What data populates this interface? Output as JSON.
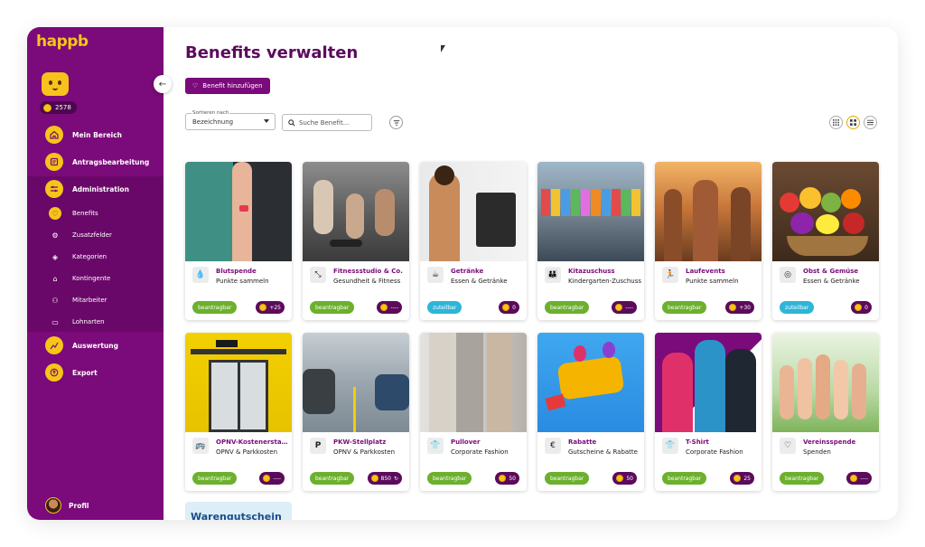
{
  "app": {
    "logo": "happb",
    "points": "2578"
  },
  "sidebar": {
    "main_items": [
      {
        "label": "Mein Bereich",
        "icon": "home-icon"
      },
      {
        "label": "Antragsbearbeitung",
        "icon": "inbox-icon"
      },
      {
        "label": "Administration",
        "icon": "sliders-icon"
      }
    ],
    "admin_items": [
      {
        "label": "Benefits",
        "icon": "heart-icon"
      },
      {
        "label": "Zusatzfelder",
        "icon": "gear-icon"
      },
      {
        "label": "Kategorien",
        "icon": "tag-icon"
      },
      {
        "label": "Kontingente",
        "icon": "bank-icon"
      },
      {
        "label": "Mitarbeiter",
        "icon": "users-icon"
      },
      {
        "label": "Lohnarten",
        "icon": "money-icon"
      }
    ],
    "bottom_items": [
      {
        "label": "Auswertung",
        "icon": "chart-icon"
      },
      {
        "label": "Export",
        "icon": "export-icon"
      }
    ],
    "profile_label": "Profil"
  },
  "main": {
    "title": "Benefits verwalten",
    "add_button": "Benefit hinzufügen",
    "sort": {
      "caption": "Sortieren nach",
      "value": "Bezeichnung"
    },
    "search_placeholder": "Suche Benefit..."
  },
  "colors": {
    "brand_purple": "#7b0a7a",
    "accent_yellow": "#f5c518",
    "status_green": "#6cb02e",
    "status_blue": "#2eb5d8"
  },
  "cards": [
    {
      "title": "Blutspende",
      "subtitle": "Punkte sammeln",
      "status": "beantragbar",
      "status_type": "green",
      "points": "+25",
      "icon": "drop-icon"
    },
    {
      "title": "Fitnessstudio & Co.",
      "subtitle": "Gesundheit & Fitness",
      "status": "beantragbar",
      "status_type": "green",
      "points": "----",
      "icon": "arrows-icon"
    },
    {
      "title": "Getränke",
      "subtitle": "Essen & Getränke",
      "status": "zuteilbar",
      "status_type": "blue",
      "points": "0",
      "icon": "cup-icon"
    },
    {
      "title": "Kitazuschuss",
      "subtitle": "Kindergarten-Zuschuss",
      "status": "beantragbar",
      "status_type": "green",
      "points": "----",
      "icon": "family-icon"
    },
    {
      "title": "Laufevents",
      "subtitle": "Punkte sammeln",
      "status": "beantragbar",
      "status_type": "green",
      "points": "+30",
      "icon": "runner-icon"
    },
    {
      "title": "Obst & Gemüse",
      "subtitle": "Essen & Getränke",
      "status": "zuteilbar",
      "status_type": "blue",
      "points": "0",
      "icon": "apple-icon"
    },
    {
      "title": "ÖPNV-Kostenerstattung",
      "subtitle": "ÖPNV & Parkkosten",
      "status": "beantragbar",
      "status_type": "green",
      "points": "----",
      "icon": "bus-icon"
    },
    {
      "title": "PKW-Stellplatz",
      "subtitle": "ÖPNV & Parkkosten",
      "status": "beantragbar",
      "status_type": "green",
      "points": "850",
      "icon": "parking-icon",
      "refresh": true
    },
    {
      "title": "Pullover",
      "subtitle": "Corporate Fashion",
      "status": "beantragbar",
      "status_type": "green",
      "points": "50",
      "icon": "shirt-icon"
    },
    {
      "title": "Rabatte",
      "subtitle": "Gutscheine & Rabatte",
      "status": "beantragbar",
      "status_type": "green",
      "points": "50",
      "icon": "euro-icon"
    },
    {
      "title": "T-Shirt",
      "subtitle": "Corporate Fashion",
      "status": "beantragbar",
      "status_type": "green",
      "points": "25",
      "icon": "shirt-icon"
    },
    {
      "title": "Vereinsspende",
      "subtitle": "Spenden",
      "status": "beantragbar",
      "status_type": "green",
      "points": "----",
      "icon": "donate-icon"
    }
  ],
  "partial_card_title": "Warengutschein"
}
